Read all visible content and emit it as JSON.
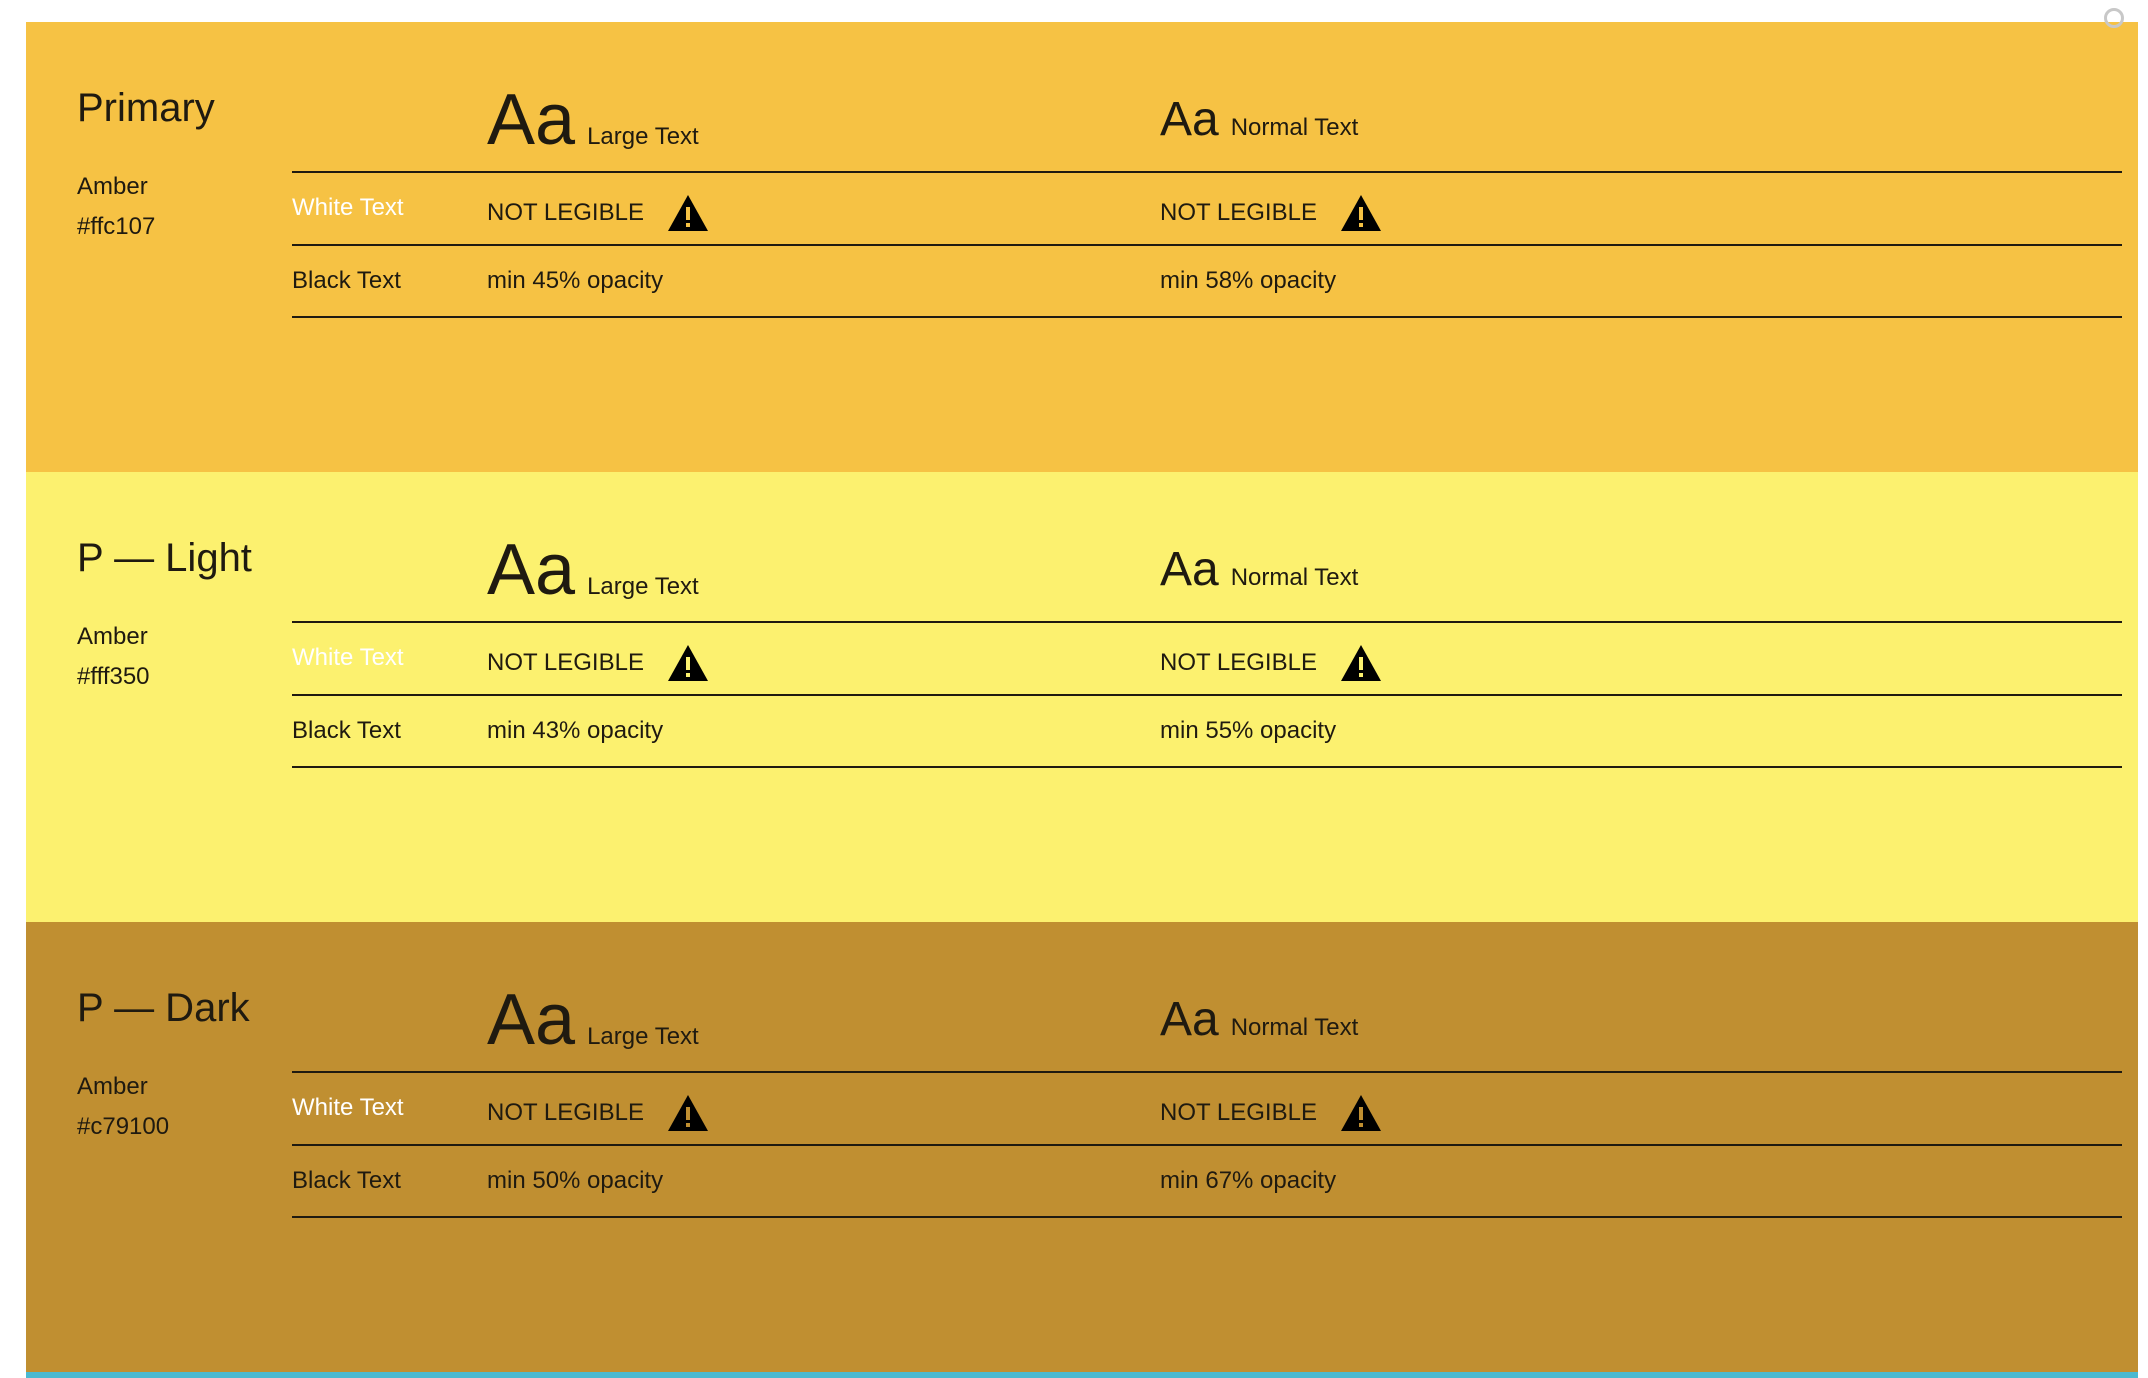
{
  "colors": {
    "page_background": "#ffffff",
    "text": "#1f1a10",
    "white_text": "#ffffff",
    "primary_panel": "#f6c244",
    "light_panel": "#fcf16f",
    "dark_panel": "#c08f31",
    "bottom_strip": "#4ab9d1",
    "warning_icon": "#000000"
  },
  "columns": {
    "large": {
      "aa": "Aa",
      "label": "Large Text"
    },
    "normal": {
      "aa": "Aa",
      "label": "Normal Text"
    }
  },
  "rows": {
    "white_label": "White Text",
    "black_label": "Black Text"
  },
  "panels": [
    {
      "name": "Primary",
      "family": "Amber",
      "hex": "#ffc107",
      "white_large": "NOT LEGIBLE",
      "white_normal": "NOT LEGIBLE",
      "black_large": "min 45% opacity",
      "black_normal": "min 58% opacity",
      "warn_icon": "warning-triangle-icon"
    },
    {
      "name": "P — Light",
      "family": "Amber",
      "hex": "#fff350",
      "white_large": "NOT LEGIBLE",
      "white_normal": "NOT LEGIBLE",
      "black_large": "min 43% opacity",
      "black_normal": "min 55% opacity",
      "warn_icon": "warning-triangle-icon"
    },
    {
      "name": "P — Dark",
      "family": "Amber",
      "hex": "#c79100",
      "white_large": "NOT LEGIBLE",
      "white_normal": "NOT LEGIBLE",
      "black_large": "min 50% opacity",
      "black_normal": "min 67% opacity",
      "warn_icon": "warning-triangle-icon"
    }
  ]
}
